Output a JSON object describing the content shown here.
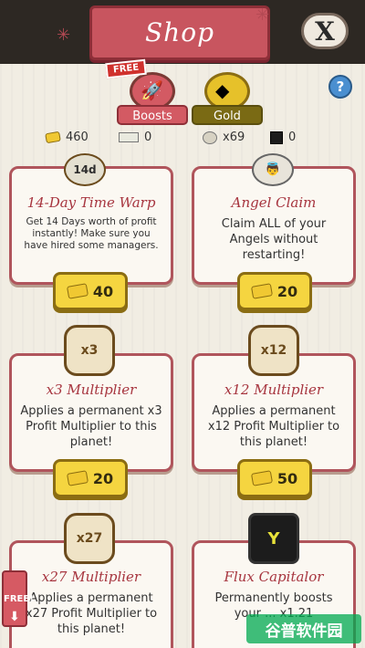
{
  "header": {
    "title": "Shop",
    "close_label": "X"
  },
  "tabs": {
    "boosts": {
      "label": "Boosts",
      "badge": "FREE"
    },
    "gold": {
      "label": "Gold"
    }
  },
  "help_label": "?",
  "currencies": [
    {
      "icon": "gold-gem",
      "value": "460"
    },
    {
      "icon": "bill",
      "value": "0"
    },
    {
      "icon": "angel",
      "value": "x69"
    },
    {
      "icon": "flux",
      "value": "0"
    }
  ],
  "cards": [
    {
      "title": "14-Day Time Warp",
      "icon_label": "14d",
      "desc": "Get 14 Days worth of profit instantly! Make sure you have hired some managers.",
      "price": "40"
    },
    {
      "title": "Angel Claim",
      "desc": "Claim ALL of your Angels without restarting!",
      "price": "20"
    },
    {
      "title": "x3 Multiplier",
      "icon_label": "x3",
      "desc": "Applies a permanent x3 Profit Multiplier to this planet!",
      "price": "20"
    },
    {
      "title": "x12 Multiplier",
      "icon_label": "x12",
      "desc": "Applies a permanent x12 Profit Multiplier to this planet!",
      "price": "50"
    },
    {
      "title": "x27 Multiplier",
      "icon_label": "x27",
      "desc": "Applies a permanent x27 Profit Multiplier to this planet!"
    },
    {
      "title": "Flux Capitalor",
      "desc": "Permanently boosts your ... x1.21"
    }
  ],
  "side_free": "FREE!",
  "watermark": "谷普软件园",
  "colors": {
    "accent": "#c8555f",
    "gold": "#f5d540",
    "card_border": "#b0555c"
  }
}
